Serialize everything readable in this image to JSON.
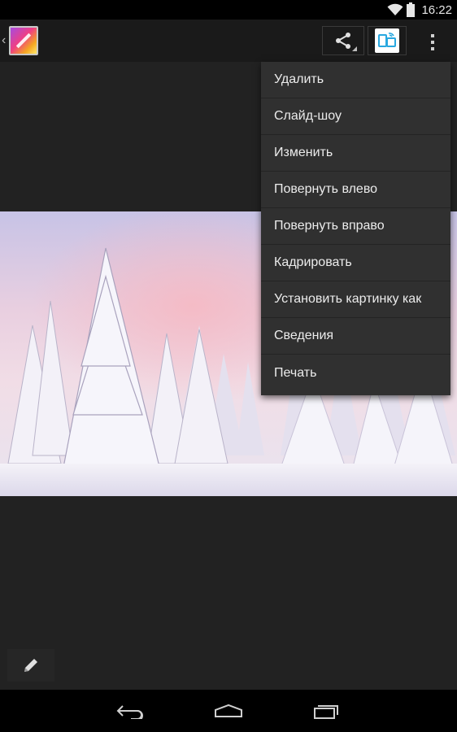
{
  "status_bar": {
    "time": "16:22",
    "icons": [
      "wifi-icon",
      "battery-icon"
    ]
  },
  "action_bar": {
    "up_icon": "chevron-left-icon",
    "app_icon": "gallery-app-icon",
    "share_icon": "share-icon",
    "cast_icon": "cast-device-icon",
    "overflow_icon": "more-vert-icon"
  },
  "menu": {
    "items": [
      {
        "label": "Удалить"
      },
      {
        "label": "Слайд-шоу"
      },
      {
        "label": "Изменить"
      },
      {
        "label": "Повернуть влево"
      },
      {
        "label": "Повернуть вправо"
      },
      {
        "label": "Кадрировать"
      },
      {
        "label": "Установить картинку как"
      },
      {
        "label": "Сведения"
      },
      {
        "label": "Печать"
      }
    ]
  },
  "photo": {
    "subject": "snow-covered-fir-trees"
  },
  "bottom": {
    "edit_icon": "pencil-icon"
  },
  "nav_bar": {
    "back_icon": "back-icon",
    "home_icon": "home-icon",
    "recents_icon": "recents-icon"
  },
  "colors": {
    "background": "#222222",
    "action_bar": "#1a1a1a",
    "menu": "#303030",
    "cast_accent": "#29a8e0"
  }
}
